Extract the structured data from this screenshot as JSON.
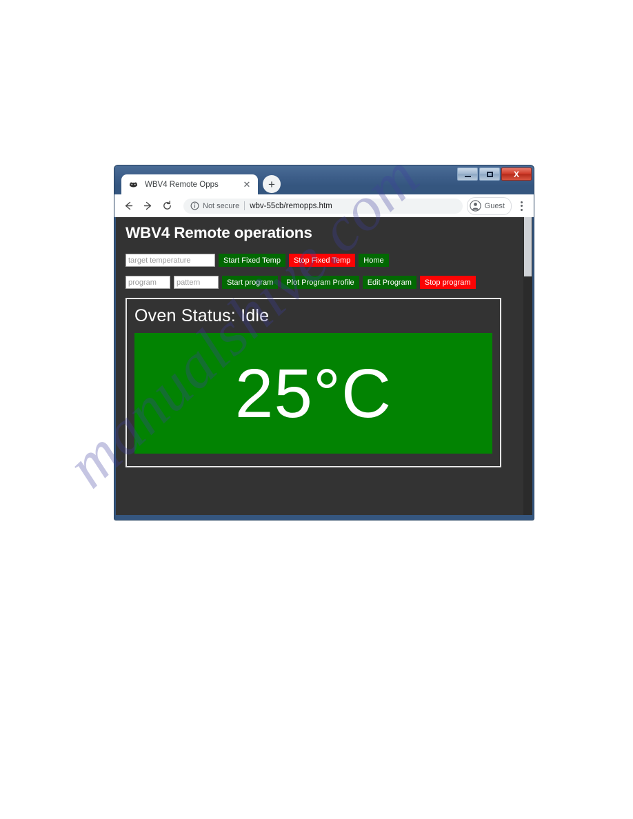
{
  "browser": {
    "window_controls": {
      "minimize_label": "–",
      "maximize_label": "□",
      "close_label": "X"
    },
    "tab": {
      "title": "WBV4 Remote Opps",
      "favicon_name": "site-favicon",
      "close_label": "✕"
    },
    "new_tab_label": "+",
    "nav": {
      "back_label": "←",
      "forward_label": "→",
      "reload_label": "⟳"
    },
    "omnibox": {
      "security_label": "Not secure",
      "url": "wbv-55cb/remopps.htm"
    },
    "profile": {
      "label": "Guest"
    },
    "menu_label": "⋮"
  },
  "page": {
    "heading": "WBV4 Remote operations",
    "fixed_temp_row": {
      "target_temperature_placeholder": "target temperature",
      "target_temperature_value": "",
      "start_fixed_temp_label": "Start Fixed Temp",
      "stop_fixed_temp_label": "Stop Fixed Temp",
      "home_label": "Home"
    },
    "program_row": {
      "program_placeholder": "program",
      "program_value": "",
      "pattern_placeholder": "pattern",
      "pattern_value": "",
      "start_program_label": "Start program",
      "plot_program_profile_label": "Plot Program Profile",
      "edit_program_label": "Edit Program",
      "stop_program_label": "Stop program"
    },
    "status_panel": {
      "oven_status_text": "Oven Status: Idle",
      "temperature_text": "25°C"
    }
  },
  "watermark": {
    "text": "manualshive.com"
  },
  "colors": {
    "green_button": "#026802",
    "red_button": "#fc0404",
    "page_background": "#333333",
    "temperature_background": "#028302",
    "window_frame": "#35567f"
  }
}
